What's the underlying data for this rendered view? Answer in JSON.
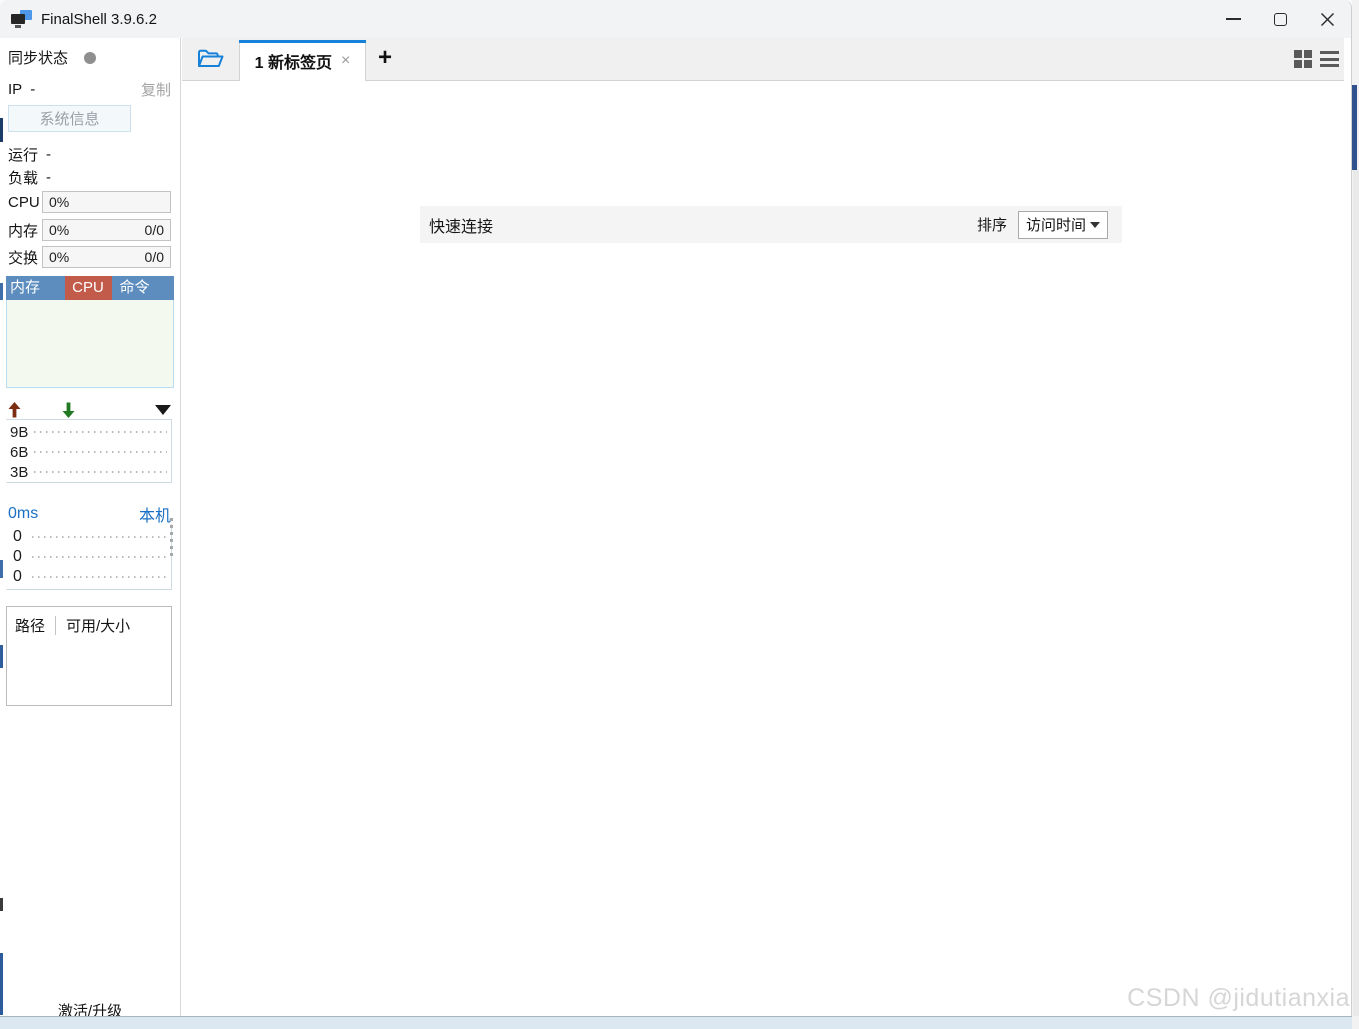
{
  "titlebar": {
    "title": "FinalShell 3.9.6.2"
  },
  "sidebar": {
    "sync_status_label": "同步状态",
    "ip_label": "IP",
    "ip_value": "-",
    "copy_button": "复制",
    "system_info_button": "系统信息",
    "run_label": "运行",
    "run_value": "-",
    "load_label": "负载",
    "load_value": "-",
    "cpu_label": "CPU",
    "cpu_value": "0%",
    "mem_label": "内存",
    "mem_value": "0%",
    "mem_ratio": "0/0",
    "swap_label": "交换",
    "swap_value": "0%",
    "swap_ratio": "0/0",
    "process_table": {
      "columns": [
        "内存",
        "CPU",
        "命令"
      ],
      "rows": []
    },
    "net_chart": {
      "ticks": [
        "9B",
        "6B",
        "3B"
      ]
    },
    "ping_chart": {
      "latency": "0ms",
      "host": "本机",
      "ticks": [
        "0",
        "0",
        "0"
      ]
    },
    "disk_table": {
      "col_path": "路径",
      "col_size": "可用/大小",
      "rows": []
    },
    "activate_link": "激活/升级"
  },
  "tabbar": {
    "tab_label": "1 新标签页",
    "close_glyph": "×",
    "new_tab_glyph": "+"
  },
  "main": {
    "quick_connect_title": "快速连接",
    "sort_label": "排序",
    "sort_value": "访问时间"
  },
  "watermark": "CSDN @jidutianxia",
  "colors": {
    "accent-blue": "#1581d8",
    "link-blue": "#1a6fc4",
    "table-header-blue": "#5d8cbf",
    "table-header-red": "#c25b49",
    "chart-body-green": "#f4f9f0",
    "bottombar-blue": "#dbe7f1"
  }
}
